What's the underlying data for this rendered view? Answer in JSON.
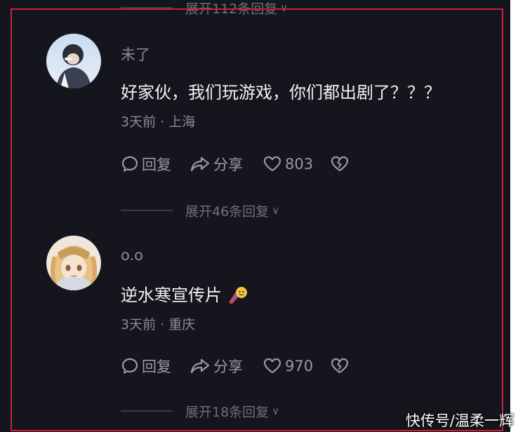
{
  "top_expand": {
    "text": "展开112条回复"
  },
  "comments": [
    {
      "username": "未了",
      "text": "好家伙，我们玩游戏，你们都出剧了？？？",
      "meta": "3天前 · 上海",
      "reply_label": "回复",
      "share_label": "分享",
      "likes": "803",
      "expand_text": "展开46条回复"
    },
    {
      "username": "o.o",
      "text": "逆水寒宣传片",
      "meta": "3天前 · 重庆",
      "reply_label": "回复",
      "share_label": "分享",
      "likes": "970",
      "expand_text": "展开18条回复"
    }
  ],
  "watermark": "快传号/温柔一辉",
  "colors": {
    "background": "#15151d",
    "frame": "#c8233a",
    "primary_text": "#f2f2f4",
    "secondary_text": "#8b8b93"
  },
  "icons": [
    "chevron-down-icon",
    "comment-icon",
    "share-icon",
    "heart-icon",
    "broken-heart-icon",
    "gift-emoji-icon"
  ]
}
